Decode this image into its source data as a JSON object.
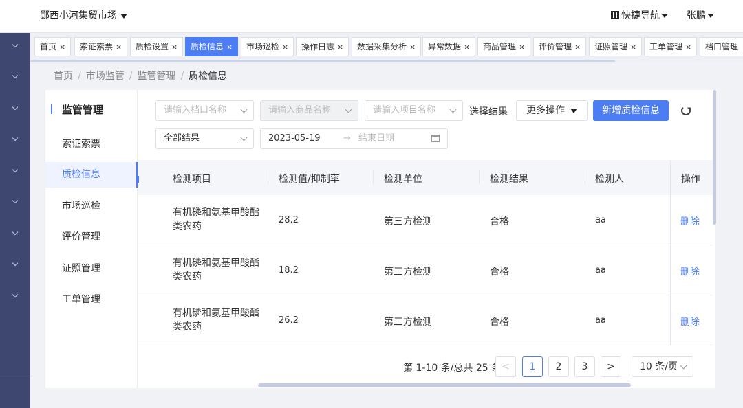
{
  "header": {
    "market_title": "郧西小河集贸市场",
    "quick_nav": "快捷导航",
    "user": "张鹏"
  },
  "tabs": [
    {
      "label": "首页",
      "active": false
    },
    {
      "label": "索证索票",
      "active": false
    },
    {
      "label": "质检设置",
      "active": false
    },
    {
      "label": "质检信息",
      "active": true
    },
    {
      "label": "市场巡检",
      "active": false
    },
    {
      "label": "操作日志",
      "active": false
    },
    {
      "label": "数据采集分析",
      "active": false
    },
    {
      "label": "异常数据",
      "active": false
    },
    {
      "label": "商品管理",
      "active": false
    },
    {
      "label": "评价管理",
      "active": false
    },
    {
      "label": "证照管理",
      "active": false
    },
    {
      "label": "工单管理",
      "active": false
    },
    {
      "label": "档口管理",
      "active": false
    }
  ],
  "tab_close": "×",
  "breadcrumb": [
    "首页",
    "市场监管",
    "监管管理",
    "质检信息"
  ],
  "breadcrumb_sep": "/",
  "inner_nav": {
    "title": "监管管理",
    "items": [
      {
        "label": "索证索票",
        "active": false
      },
      {
        "label": "质检信息",
        "active": true
      },
      {
        "label": "市场巡检",
        "active": false
      },
      {
        "label": "评价管理",
        "active": false
      },
      {
        "label": "证照管理",
        "active": false
      },
      {
        "label": "工单管理",
        "active": false
      }
    ]
  },
  "filters": {
    "stall_placeholder": "请输入档口名称",
    "product_placeholder": "请输入商品名称",
    "item_placeholder": "请输入项目名称",
    "result_label": "选择结果",
    "more_actions": "更多操作",
    "add_button": "新增质检信息",
    "result_select": "全部结果",
    "date_start": "2023-05-19",
    "date_arrow": "→",
    "date_end_placeholder": "结束日期"
  },
  "table": {
    "columns": [
      "检测项目",
      "检测值/抑制率",
      "检测单位",
      "检测结果",
      "检测人",
      "操作"
    ],
    "rows": [
      {
        "item": "有机磷和氨基甲酸酯类农药",
        "value": "28.2",
        "unit": "第三方检测",
        "result": "合格",
        "inspector": "aa",
        "action": "删除"
      },
      {
        "item": "有机磷和氨基甲酸酯类农药",
        "value": "18.2",
        "unit": "第三方检测",
        "result": "合格",
        "inspector": "aa",
        "action": "删除"
      },
      {
        "item": "有机磷和氨基甲酸酯类农药",
        "value": "26.2",
        "unit": "第三方检测",
        "result": "合格",
        "inspector": "aa",
        "action": "删除"
      }
    ]
  },
  "pagination": {
    "total_text": "第 1-10 条/总共 25 条",
    "prev": "<",
    "pages": [
      "1",
      "2",
      "3"
    ],
    "current": "1",
    "next": ">",
    "page_size": "10 条/页"
  },
  "colors": {
    "primary": "#4d7df3",
    "sidebar": "#3d4770"
  }
}
